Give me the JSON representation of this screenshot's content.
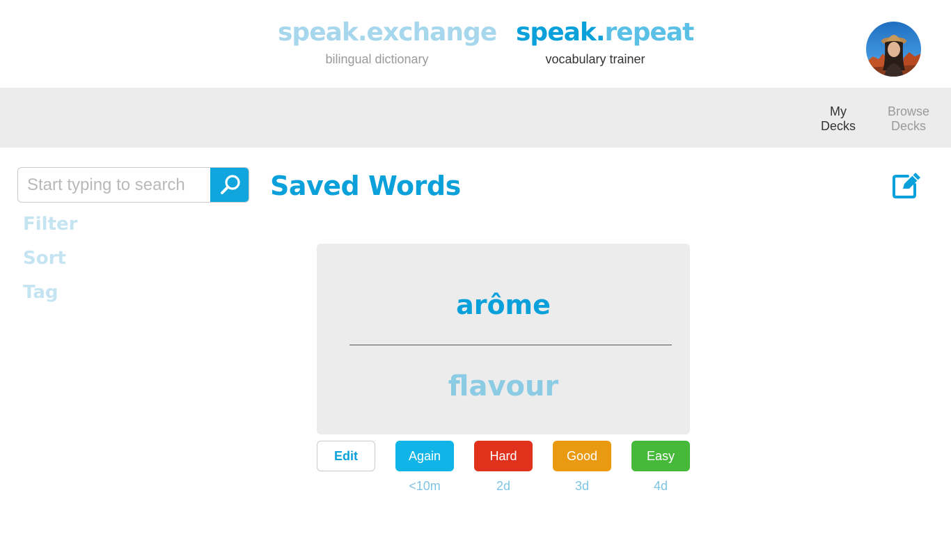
{
  "header": {
    "exchange": {
      "name_1": "speak.",
      "name_2": "exchange",
      "subtitle": "bilingual dictionary"
    },
    "repeat": {
      "name_1": "speak.",
      "name_2": "repeat",
      "subtitle": "vocabulary trainer"
    },
    "avatar_icon": "user-avatar-photo"
  },
  "nav": {
    "my_decks": {
      "line1": "My",
      "line2": "Decks"
    },
    "browse_decks": {
      "line1": "Browse",
      "line2": "Decks"
    }
  },
  "sidebar": {
    "search_placeholder": "Start typing to search",
    "search_value": "",
    "search_icon": "search-icon",
    "links": [
      "Filter",
      "Sort",
      "Tag"
    ]
  },
  "main": {
    "title": "Saved Words",
    "edit_icon": "edit-icon"
  },
  "card": {
    "front": "arôme",
    "back": "flavour"
  },
  "actions": {
    "edit": "Edit",
    "again": "Again",
    "hard": "Hard",
    "good": "Good",
    "easy": "Easy"
  },
  "intervals": {
    "again": "<10m",
    "hard": "2d",
    "good": "3d",
    "easy": "4d"
  },
  "colors": {
    "primary": "#0aa1da",
    "light_blue": "#a7d7ec",
    "again": "#10b4e6",
    "hard": "#e0311c",
    "good": "#ea9a10",
    "easy": "#46b83a",
    "panel_gray": "#ececec"
  }
}
